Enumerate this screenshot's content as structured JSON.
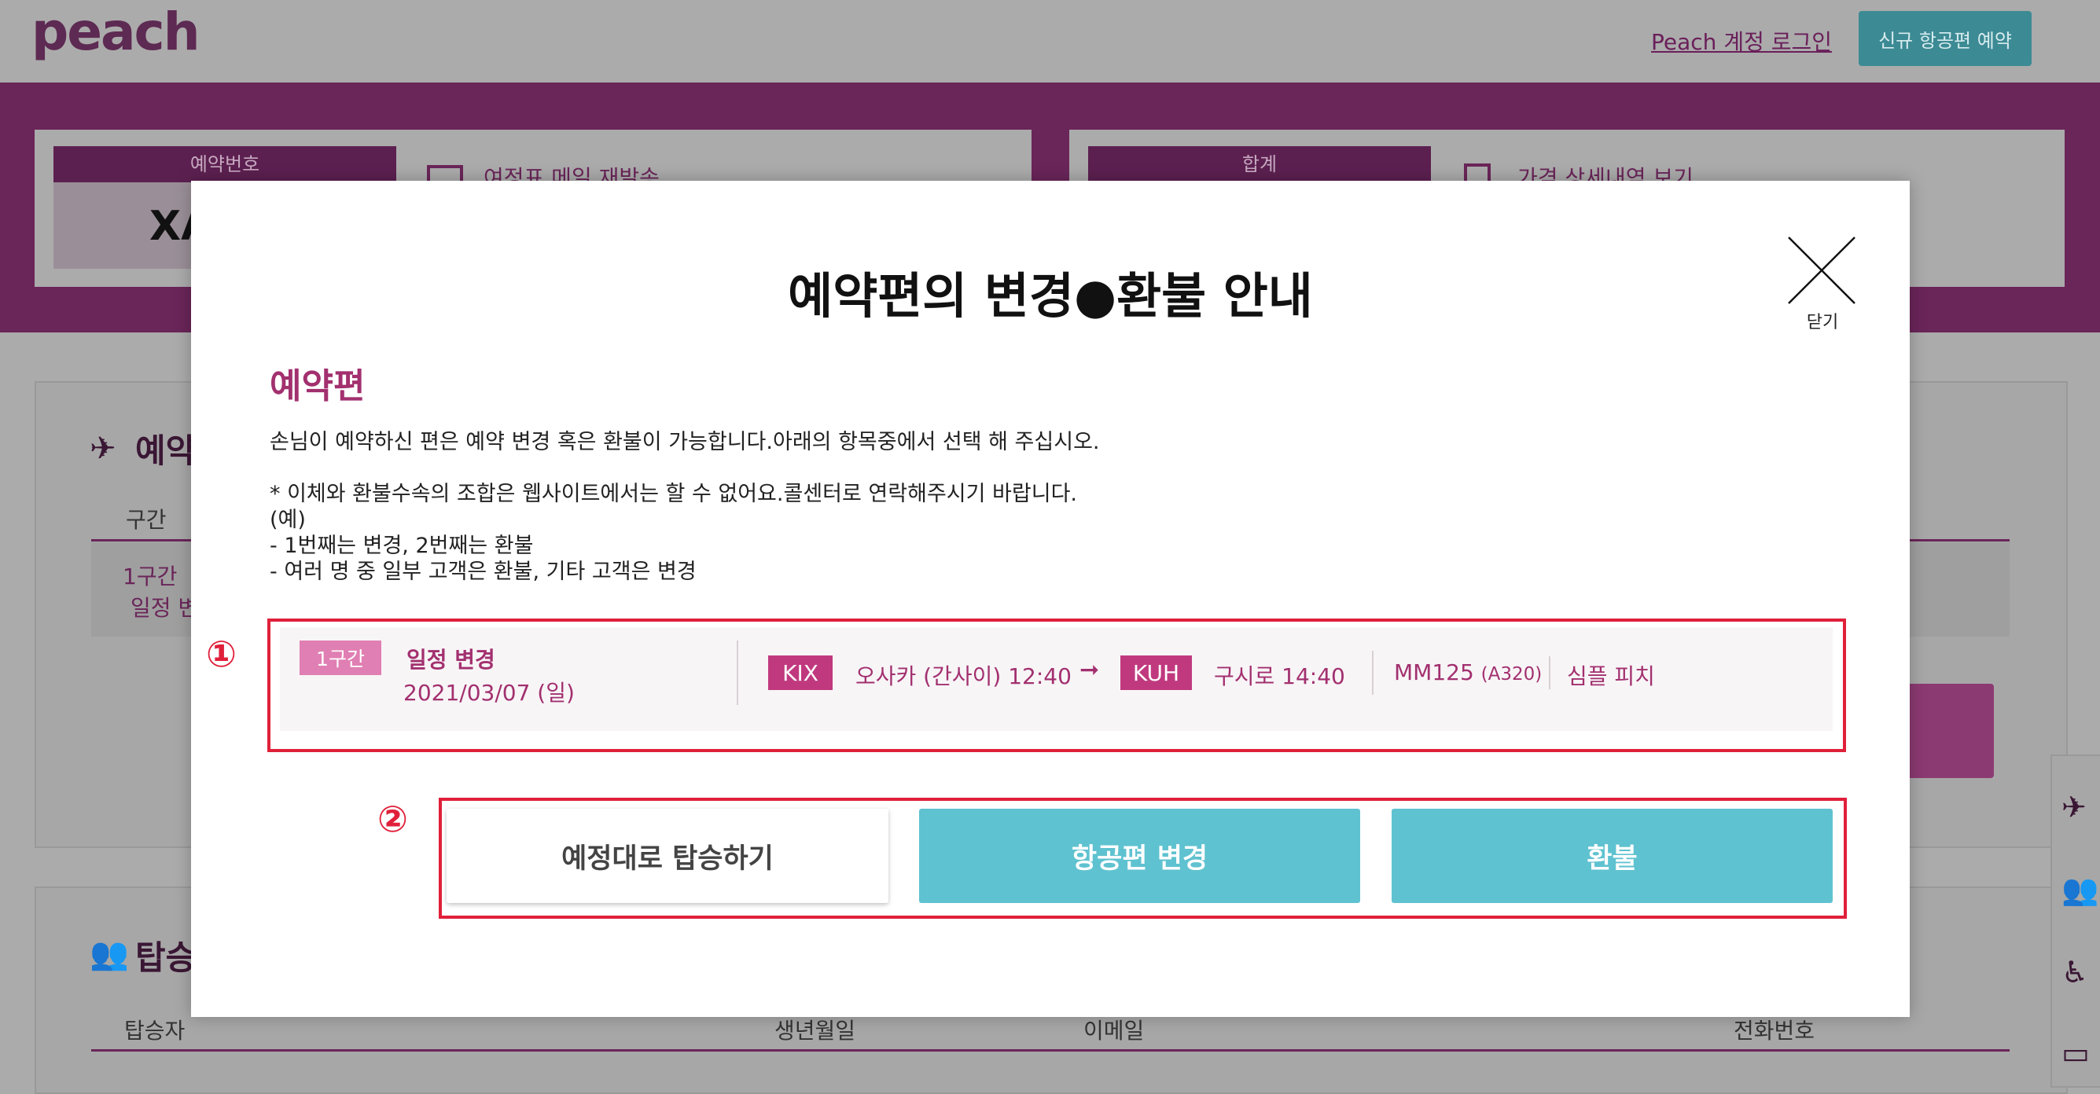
{
  "header": {
    "logo": "peach",
    "login_link": "Peach 계정 로그인",
    "new_booking_button": "신규 항공편 예약"
  },
  "background": {
    "reservation_label": "예약번호",
    "reservation_number": "XA",
    "resend_link": "여정표 메일 재발송",
    "total_label": "합계",
    "price_detail_link": "가격 상세내역 보기",
    "section1_title": "예약",
    "col_segment": "구간",
    "segment_cell_1": "1구간",
    "segment_cell_2": "일정 변",
    "section2_title": "탑승",
    "col_passenger": "탑승자",
    "col_birth": "생년월일",
    "col_email": "이메일",
    "col_phone": "전화번호"
  },
  "modal": {
    "title": "예약편의 변경●환불 안내",
    "close_label": "닫기",
    "section_label": "예약편",
    "description": "손님이 예약하신 편은 예약 변경 혹은 환불이 가능합니다.아래의 항목중에서 선택 해 주십시오.",
    "note_lines": [
      "* 이체와 환불수속의 조합은 웹사이트에서는 할 수 없어요.콜센터로 연락해주시기 바랍니다.",
      "(예)",
      "- 1번째는 변경, 2번째는 환불",
      "- 여러 명 중 일부 고객은 환불, 기타 고객은 변경"
    ],
    "annotation_1": "①",
    "annotation_2": "②",
    "flight": {
      "segment_tag": "1구간",
      "action": "일정 변경",
      "date": "2021/03/07 (일)",
      "from_code": "KIX",
      "from_text": "오사카 (간사이) 12:40",
      "arrow": "➞",
      "to_code": "KUH",
      "to_text": "구시로 14:40",
      "flight_no": "MM125",
      "aircraft": "(A320)",
      "fare": "심플 피치"
    },
    "buttons": {
      "keep": "예정대로 탑승하기",
      "change": "항공편 변경",
      "refund": "환불"
    }
  },
  "colors": {
    "brand_purple": "#a2306f",
    "teal": "#5fc2d0",
    "annotation_red": "#e0203a"
  }
}
